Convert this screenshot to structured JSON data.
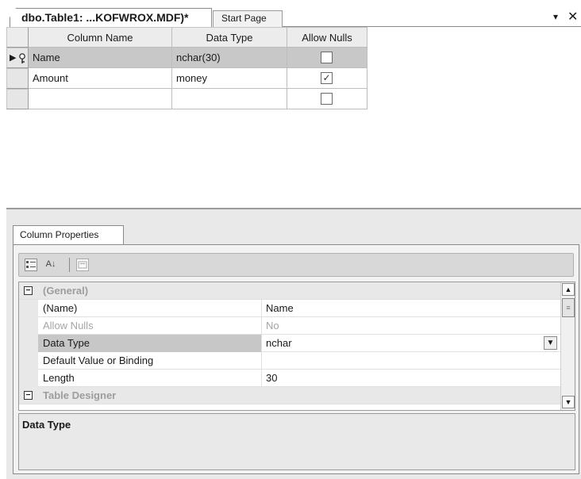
{
  "tabs": {
    "active_label": "dbo.Table1: ...KOFWROX.MDF)*",
    "inactive_label": "Start Page",
    "dropdown_glyph": "▾",
    "close_glyph": "✕"
  },
  "grid": {
    "headers": [
      "Column Name",
      "Data Type",
      "Allow Nulls"
    ],
    "rows": [
      {
        "name": "Name",
        "type": "nchar(30)",
        "allow_nulls": false,
        "selected": true,
        "is_key": true
      },
      {
        "name": "Amount",
        "type": "money",
        "allow_nulls": true,
        "selected": false,
        "is_key": false
      },
      {
        "name": "",
        "type": "",
        "allow_nulls": false,
        "selected": false,
        "is_key": false
      }
    ],
    "row_indicator": "▶",
    "key_icon": "key-icon",
    "check_glyph": "✓"
  },
  "properties": {
    "tab_label": "Column Properties",
    "toolbar": {
      "categorized_icon": "categorized-icon",
      "alphabetical_icon": "sort-alphabetical-icon",
      "alpha_glyph": "A↓",
      "pages_icon": "property-pages-icon"
    },
    "categories": {
      "general": "(General)",
      "table_designer": "Table Designer"
    },
    "collapse_glyph": "−",
    "items": [
      {
        "name": "(Name)",
        "value": "Name"
      },
      {
        "name": "Allow Nulls",
        "value": "No"
      },
      {
        "name": "Data Type",
        "value": "nchar"
      },
      {
        "name": "Default Value or Binding",
        "value": ""
      },
      {
        "name": "Length",
        "value": "30"
      }
    ],
    "description_title": "Data Type"
  },
  "glyphs": {
    "scroll_up": "▲",
    "scroll_down": "▼",
    "dropdown": "▼",
    "thumb_grip": "≡"
  },
  "colors": {
    "selected_row": "#c8c8c8",
    "header_bg": "#ececec",
    "panel_bg": "#e9e9e9"
  }
}
